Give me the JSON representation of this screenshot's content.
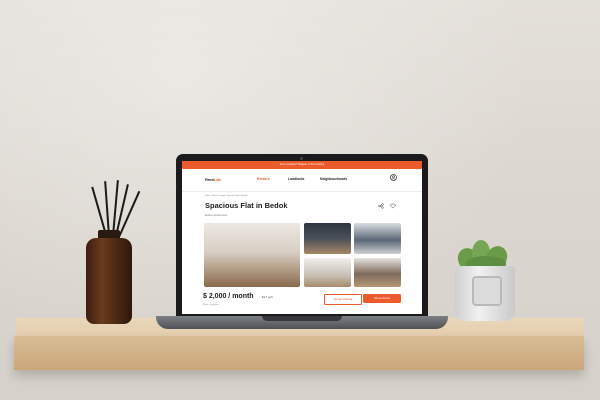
{
  "scene": {
    "accent_color": "#ec5b2c",
    "shelf_color": "#d9bd95",
    "wall_color": "#e0dcd5"
  },
  "promo_bar": {
    "text": "Rent a property? Register or Post a listing"
  },
  "nav": {
    "logo_main": "Rent",
    "logo_accent": "Lah",
    "links": [
      "Renters",
      "Landlords",
      "Neighbourhoods"
    ],
    "user_icon": "user-circle-icon"
  },
  "listing": {
    "breadcrumbs": "Home › Rental Listings › Spacious Flat in Bedok",
    "title": "Spacious Flat in Bedok",
    "subtitle": "Entire apartment",
    "price": "$ 2,000 / month",
    "price_psf": "$17 psft",
    "address": "Bedok, Singapore",
    "virtual_button": "Virtual Viewing",
    "photos_button": "Show photos",
    "share_icon": "share-icon",
    "save_icon": "heart-icon"
  }
}
